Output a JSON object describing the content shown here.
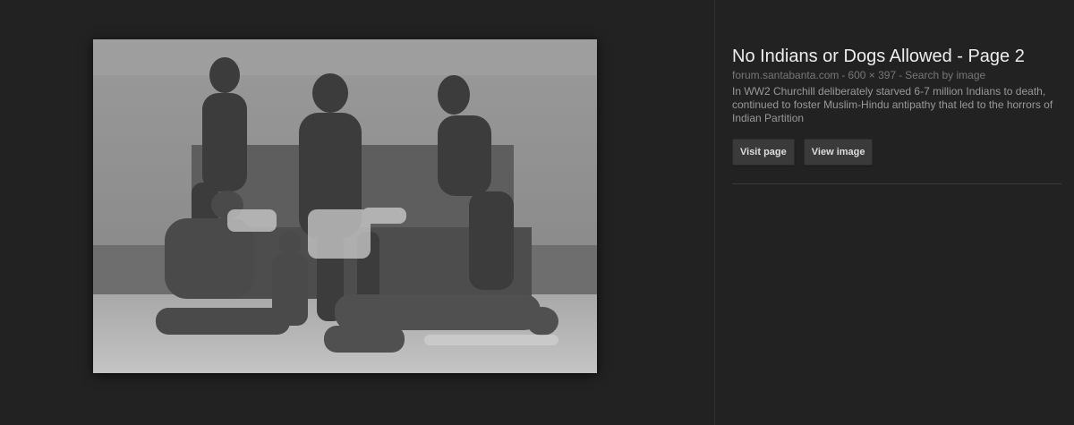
{
  "result": {
    "title": "No Indians or Dogs Allowed - Page 2",
    "source": "forum.santabanta.com",
    "dimensions": "600 × 397",
    "separator": "-",
    "search_by_image": "Search by image",
    "description": "In WW2 Churchill deliberately starved 6-7 million Indians to death, continued to foster Muslim-Hindu antipathy that led to the horrors of Indian Partition"
  },
  "buttons": {
    "visit_page": "Visit page",
    "view_image": "View image"
  },
  "colors": {
    "background": "#222222",
    "title": "#eeeeee",
    "meta": "#777777",
    "description": "#999999",
    "button_bg": "#3a3a3a"
  }
}
